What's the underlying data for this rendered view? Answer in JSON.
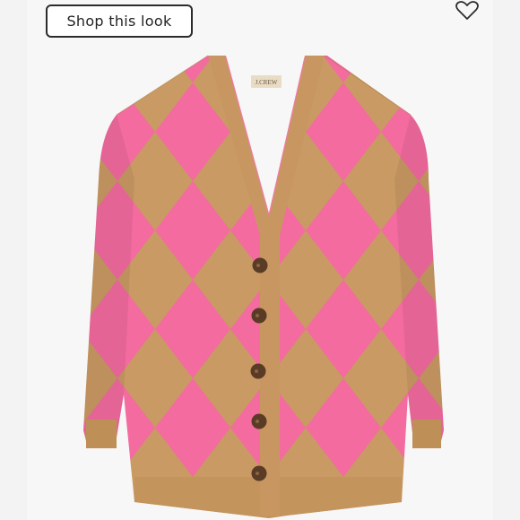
{
  "shop_look": {
    "label": "Shop this look"
  },
  "favorite": {
    "icon": "heart-outline-icon"
  },
  "product": {
    "brand_label": "J.CREW",
    "colors": {
      "camel": "#c99a63",
      "pink": "#f26a9e",
      "button": "#5a3b26",
      "background": "#f7f7f7"
    },
    "button_count": 5
  }
}
